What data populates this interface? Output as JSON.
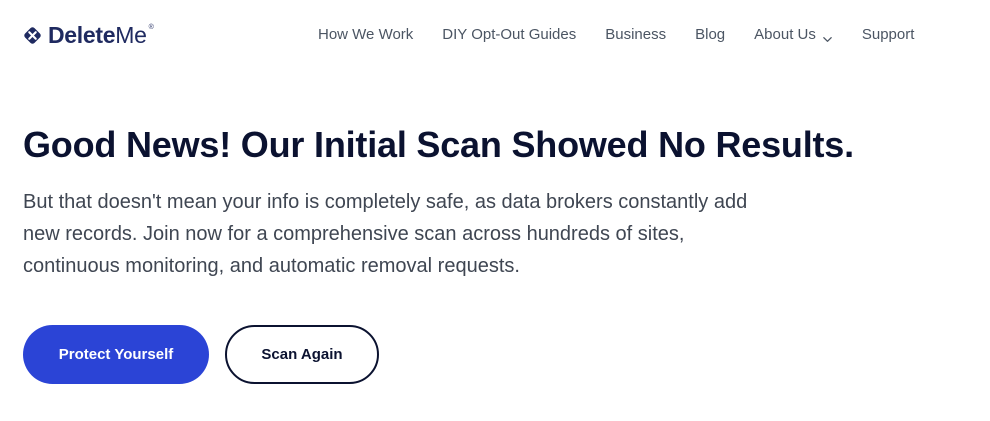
{
  "header": {
    "logo": {
      "icon": "x-badge-icon",
      "text_bold": "Delete",
      "text_light": "Me",
      "registered": "®"
    },
    "nav": [
      {
        "label": "How We Work"
      },
      {
        "label": "DIY Opt-Out Guides"
      },
      {
        "label": "Business"
      },
      {
        "label": "Blog"
      },
      {
        "label": "About Us",
        "icon": "chevron-down-icon"
      },
      {
        "label": "Support"
      }
    ]
  },
  "main": {
    "headline": "Good News! Our Initial Scan Showed No Results.",
    "subtext": "But that doesn't mean your info is completely safe, as data brokers constantly add new records. Join now for a comprehensive scan across hundreds of sites, continuous monitoring, and automatic removal requests.",
    "buttons": {
      "primary_label": "Protect Yourself",
      "secondary_label": "Scan Again"
    }
  },
  "colors": {
    "brand_navy": "#1f2a60",
    "primary_button": "#2b44d6",
    "heading": "#0b1230",
    "body_text": "#3f4652",
    "nav_text": "#4b5563",
    "background": "#ffffff"
  }
}
